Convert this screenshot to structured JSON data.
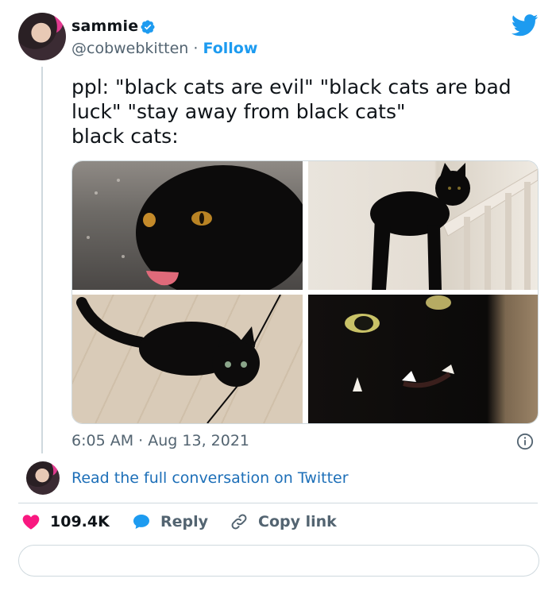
{
  "user": {
    "name": "sammie",
    "handle": "@cobwebkitten",
    "separator": "·",
    "follow_label": "Follow"
  },
  "tweet": {
    "text": "ppl: \"black cats are evil\" \"black cats are bad\nluck\" \"stay away from black cats\"\nblack cats:",
    "time": "6:05 AM",
    "separator": "·",
    "date": "Aug 13, 2021"
  },
  "conversation": {
    "link_text": "Read the full conversation on Twitter"
  },
  "actions": {
    "likes": "109.4K",
    "reply_label": "Reply",
    "copy_link_label": "Copy link"
  },
  "colors": {
    "accent": "#1d9bf0",
    "like": "#f91880",
    "text_secondary": "#536471"
  },
  "icons": [
    "verified-badge-icon",
    "twitter-bird-icon",
    "info-icon",
    "heart-icon",
    "reply-bubble-icon",
    "link-icon"
  ]
}
